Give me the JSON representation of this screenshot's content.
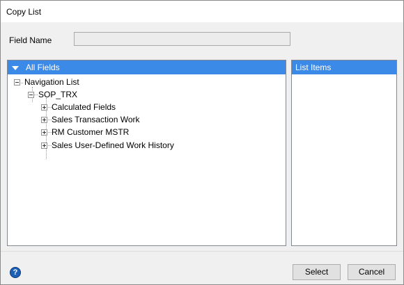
{
  "window": {
    "title": "Copy List"
  },
  "field": {
    "label": "Field Name",
    "value": ""
  },
  "all_fields": {
    "header": "All Fields",
    "tree": {
      "root": "Navigation List",
      "child": "SOP_TRX",
      "items": [
        "Calculated Fields",
        "Sales Transaction Work",
        "RM Customer MSTR",
        "Sales User-Defined Work History"
      ]
    }
  },
  "list_items": {
    "header": "List Items"
  },
  "buttons": {
    "select": "Select",
    "cancel": "Cancel",
    "help": "?"
  },
  "colors": {
    "header_bg": "#3c8ae8",
    "window_bg": "#f0f0f0"
  },
  "icons": {
    "dropdown": "triangle-down",
    "help": "help-circle-icon",
    "expand": "plus-box",
    "collapse": "minus-box"
  }
}
